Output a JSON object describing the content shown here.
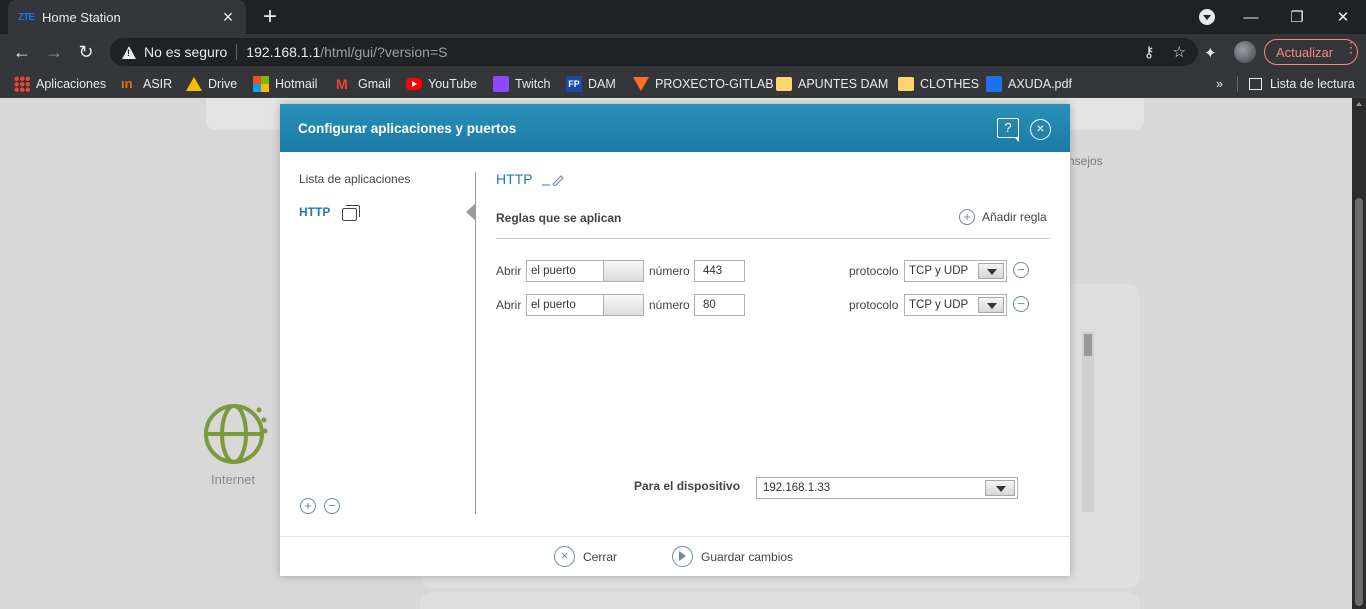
{
  "browser": {
    "tab_title": "Home Station",
    "tab_favicon": "ZTE",
    "secure_text": "No es seguro",
    "url_host": "192.168.1.1",
    "url_path": "/html/gui/?version=S",
    "update_label": "Actualizar",
    "bookmarks": [
      {
        "label": "Aplicaciones",
        "icon": "apps-grid-icon"
      },
      {
        "label": "ASIR",
        "icon": "asir-icon"
      },
      {
        "label": "Drive",
        "icon": "drive-icon"
      },
      {
        "label": "Hotmail",
        "icon": "microsoft-icon"
      },
      {
        "label": "Gmail",
        "icon": "gmail-icon"
      },
      {
        "label": "YouTube",
        "icon": "youtube-icon"
      },
      {
        "label": "Twitch",
        "icon": "twitch-icon"
      },
      {
        "label": "DAM",
        "icon": "fp-icon"
      },
      {
        "label": "PROXECTO-GITLAB",
        "icon": "gitlab-icon"
      },
      {
        "label": "APUNTES DAM",
        "icon": "folder-icon"
      },
      {
        "label": "CLOTHES",
        "icon": "folder-icon"
      },
      {
        "label": "AXUDA.pdf",
        "icon": "pdf-icon"
      }
    ],
    "more_bookmarks": "»",
    "reading_list": "Lista de lectura"
  },
  "background": {
    "internet_label": "Internet",
    "consejos_fragment": "nsejos"
  },
  "modal": {
    "title": "Configurar aplicaciones y puertos",
    "help_icon": "?",
    "close_icon": "×",
    "list_title": "Lista de aplicaciones",
    "apps": [
      "HTTP"
    ],
    "app_name": "HTTP",
    "rules_title": "Reglas que se aplican",
    "add_rule": "Añadir regla",
    "rules": [
      {
        "open": "Abrir",
        "type": "el puerto",
        "number_label": "número",
        "number": "443",
        "protocol_label": "protocolo",
        "protocol": "TCP y UDP"
      },
      {
        "open": "Abrir",
        "type": "el puerto",
        "number_label": "número",
        "number": "80",
        "protocol_label": "protocolo",
        "protocol": "TCP y UDP"
      }
    ],
    "device_label": "Para el dispositivo",
    "device_value": "192.168.1.33",
    "footer": {
      "close": "Cerrar",
      "save": "Guardar cambios"
    },
    "colors": {
      "header": "#1a7aa4",
      "link": "#1d7ab3"
    }
  }
}
